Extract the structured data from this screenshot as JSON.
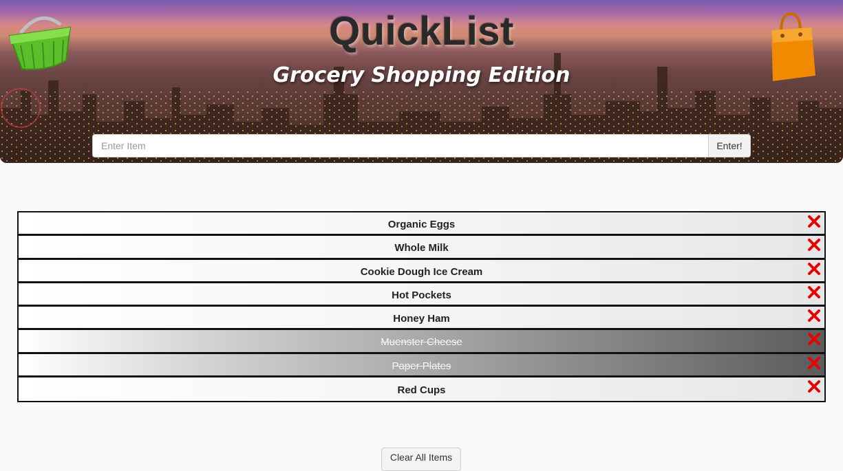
{
  "header": {
    "title": "QuickList",
    "subtitle": "Grocery Shopping Edition",
    "left_icon": "shopping-basket-icon",
    "right_icon": "shopping-bag-icon"
  },
  "entry": {
    "placeholder": "Enter Item",
    "value": "",
    "submit_label": "Enter!"
  },
  "list": {
    "items": [
      {
        "label": "Organic Eggs",
        "done": false
      },
      {
        "label": "Whole Milk",
        "done": false
      },
      {
        "label": "Cookie Dough Ice Cream",
        "done": false
      },
      {
        "label": "Hot Pockets",
        "done": false
      },
      {
        "label": "Honey Ham",
        "done": false
      },
      {
        "label": "Muenster Cheese",
        "done": true
      },
      {
        "label": "Paper Plates",
        "done": true
      },
      {
        "label": "Red Cups",
        "done": false
      }
    ],
    "delete_icon": "close-x-icon"
  },
  "footer": {
    "clear_label": "Clear All Items"
  },
  "colors": {
    "delete": "#e60000",
    "basket": "#5cbf2a",
    "bag": "#f08a00",
    "list_border": "#111111"
  }
}
